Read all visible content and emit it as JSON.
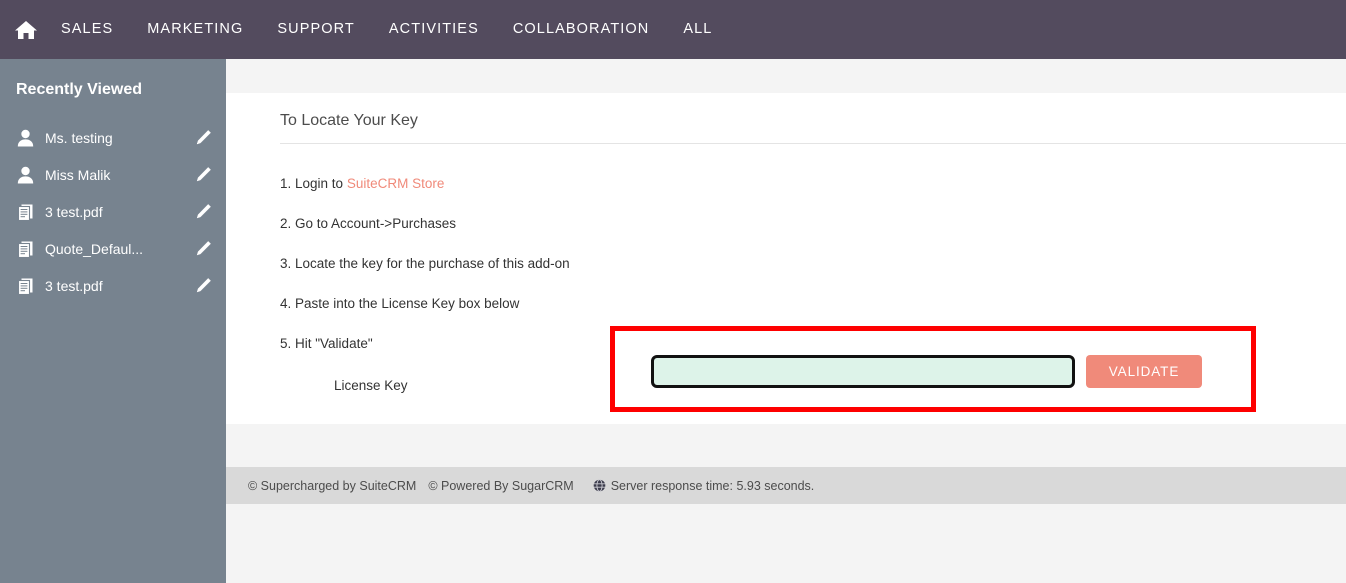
{
  "topnav": {
    "home_icon": "home-icon",
    "items": [
      {
        "label": "SALES"
      },
      {
        "label": "MARKETING"
      },
      {
        "label": "SUPPORT"
      },
      {
        "label": "ACTIVITIES"
      },
      {
        "label": "COLLABORATION"
      },
      {
        "label": "ALL"
      }
    ]
  },
  "sidebar": {
    "title": "Recently Viewed",
    "collapse_icon": "caret-left-icon",
    "items": [
      {
        "label": "Ms. testing",
        "icon": "person-icon",
        "edit_icon": "pencil-icon"
      },
      {
        "label": "Miss Malik",
        "icon": "person-icon",
        "edit_icon": "pencil-icon"
      },
      {
        "label": "3 test.pdf",
        "icon": "document-icon",
        "edit_icon": "pencil-icon"
      },
      {
        "label": "Quote_Defaul...",
        "icon": "document-icon",
        "edit_icon": "pencil-icon"
      },
      {
        "label": "3 test.pdf",
        "icon": "document-icon",
        "edit_icon": "pencil-icon"
      }
    ]
  },
  "panel": {
    "title": "To Locate Your Key",
    "steps": [
      {
        "prefix": "1. Login to ",
        "link": "SuiteCRM Store",
        "suffix": ""
      },
      {
        "prefix": "2. Go to Account->Purchases",
        "link": "",
        "suffix": ""
      },
      {
        "prefix": "3. Locate the key for the purchase of this add-on",
        "link": "",
        "suffix": ""
      },
      {
        "prefix": "4. Paste into the License Key box below",
        "link": "",
        "suffix": ""
      },
      {
        "prefix": "5. Hit \"Validate\"",
        "link": "",
        "suffix": ""
      }
    ],
    "license_label": "License Key",
    "license_value": "",
    "license_placeholder": "",
    "validate_label": "VALIDATE"
  },
  "footer": {
    "supercharged": "© Supercharged by SuiteCRM",
    "powered": "© Powered By SugarCRM",
    "server_time": "Server response time: 5.93 seconds.",
    "globe_icon": "globe-icon"
  },
  "colors": {
    "nav_bg": "#534b5e",
    "sidebar_bg": "#77838f",
    "accent": "#f08a7a",
    "highlight": "#fe0000",
    "input_bg": "#ddf3e9",
    "page_bg": "#f4f4f4",
    "footer_bg": "#d9d9d9"
  }
}
